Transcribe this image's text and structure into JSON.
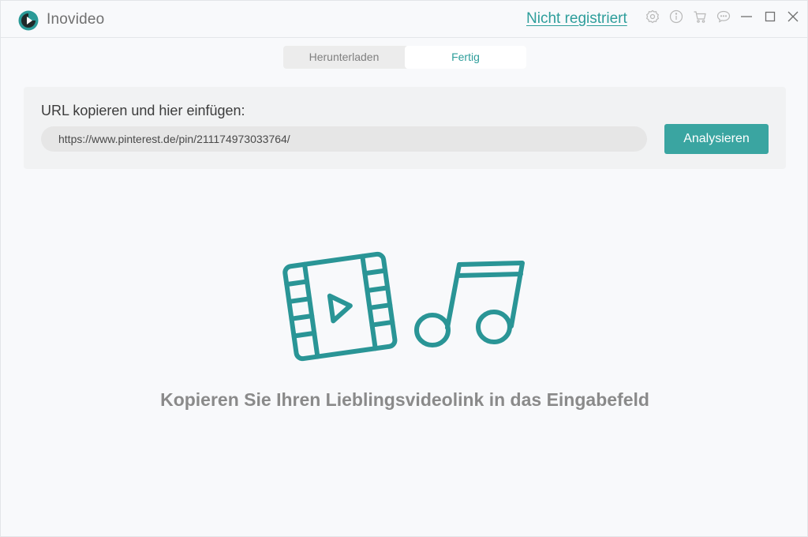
{
  "app": {
    "title": "Inovideo",
    "register_link": "Nicht registriert",
    "accent_color": "#2e9e9b",
    "logo_icon": "inovideo-logo"
  },
  "titlebar_icons": [
    {
      "name": "settings-icon"
    },
    {
      "name": "info-icon"
    },
    {
      "name": "cart-icon"
    },
    {
      "name": "feedback-icon"
    },
    {
      "name": "minimize-icon"
    },
    {
      "name": "maximize-icon"
    },
    {
      "name": "close-icon"
    }
  ],
  "tabs": [
    {
      "label": "Herunterladen",
      "active": false
    },
    {
      "label": "Fertig",
      "active": true
    }
  ],
  "url_panel": {
    "label": "URL kopieren und hier einfügen:",
    "input_value": "https://www.pinterest.de/pin/211174973033764/",
    "button_label": "Analysieren"
  },
  "empty_state": {
    "illustration": "video-film-and-music-note-icon",
    "message": "Kopieren Sie Ihren Lieblingsvideolink in das Eingabefeld"
  }
}
